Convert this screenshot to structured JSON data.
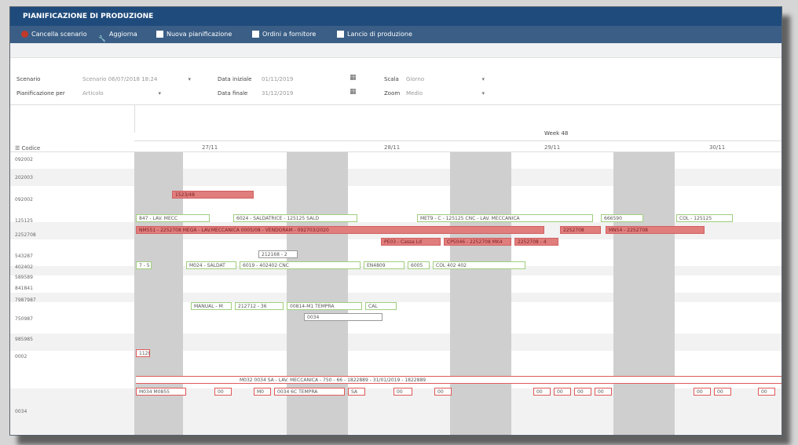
{
  "title": "PIANIFICAZIONE DI PRODUZIONE",
  "toolbar": {
    "cancel": "Cancella scenario",
    "refresh": "Aggiorna",
    "new_plan": "Nuova pianificazione",
    "supplier_orders": "Ordini a fornitore",
    "production_launch": "Lancio di produzione"
  },
  "form": {
    "scenario_label": "Scenario",
    "scenario_value": "Scenario 06/07/2018 18:24",
    "plan_by_label": "Pianificazione per",
    "plan_by_value": "Articolo",
    "start_label": "Data iniziale",
    "start_value": "01/11/2019",
    "end_label": "Data finale",
    "end_value": "31/12/2019",
    "scale_label": "Scala",
    "scale_value": "Giorno",
    "zoom_label": "Zoom",
    "zoom_value": "Medio"
  },
  "gantt": {
    "code_header": "Codice",
    "week_label": "Week 48",
    "days": [
      "27/11",
      "28/11",
      "29/11",
      "30/11"
    ],
    "rows": [
      "092002",
      "202003",
      "092002",
      "125125",
      "2252708",
      "543287",
      "402402",
      "589589",
      "841841",
      "7987987",
      "750987",
      "985985",
      "0002",
      "0034"
    ],
    "bars": [
      {
        "text": "1523/48"
      },
      {
        "text": "847 - LAV. MECC"
      },
      {
        "text": "6024 - SALDATRICE - 125125 SALD"
      },
      {
        "text": "MET9 - C - 125125 CNC - LAV. MECCANICA"
      },
      {
        "text": "666590"
      },
      {
        "text": "COL - 125125"
      },
      {
        "text": "NM551 - 2252708 MEGA - LAV.MECCANICA 0005/08 - VENDORAM - 092703/2020"
      },
      {
        "text": "2252708"
      },
      {
        "text": "MN54 - 2252708"
      },
      {
        "text": "PE03 - Cassa Ld"
      },
      {
        "text": "CP5046 - 2252708 MK4"
      },
      {
        "text": "2252708 - 4"
      },
      {
        "text": "212168 - 2"
      },
      {
        "text": "7 - 5"
      },
      {
        "text": "M024 - SALDAT"
      },
      {
        "text": "6019 - 402402 CNC"
      },
      {
        "text": "EN4809"
      },
      {
        "text": "6005"
      },
      {
        "text": "COL 402 402"
      },
      {
        "text": "MANUAL - M"
      },
      {
        "text": "212712 - 36"
      },
      {
        "text": "00814-M1 TEMPRA"
      },
      {
        "text": "CAL"
      },
      {
        "text": "0034"
      },
      {
        "text": "1128"
      },
      {
        "text": "M032 0034 SA - LAV. MECCANICA - 750 - 66 - 1822889 - 31/01/2019 - 1822889"
      },
      {
        "text": "M034 M0855"
      },
      {
        "text": "00"
      },
      {
        "text": "M0"
      },
      {
        "text": "0034 6C TEMPRA"
      },
      {
        "text": "SA"
      },
      {
        "text": "00"
      },
      {
        "text": "00"
      },
      {
        "text": "00"
      },
      {
        "text": "00"
      },
      {
        "text": "00"
      },
      {
        "text": "00"
      },
      {
        "text": "00"
      },
      {
        "text": "00"
      },
      {
        "text": "00"
      }
    ]
  },
  "colors": {
    "title": "#1f4b7c",
    "toolbar": "#3a5e86",
    "green_border": "#9fce7d",
    "red_bar": "#e07d7d"
  }
}
